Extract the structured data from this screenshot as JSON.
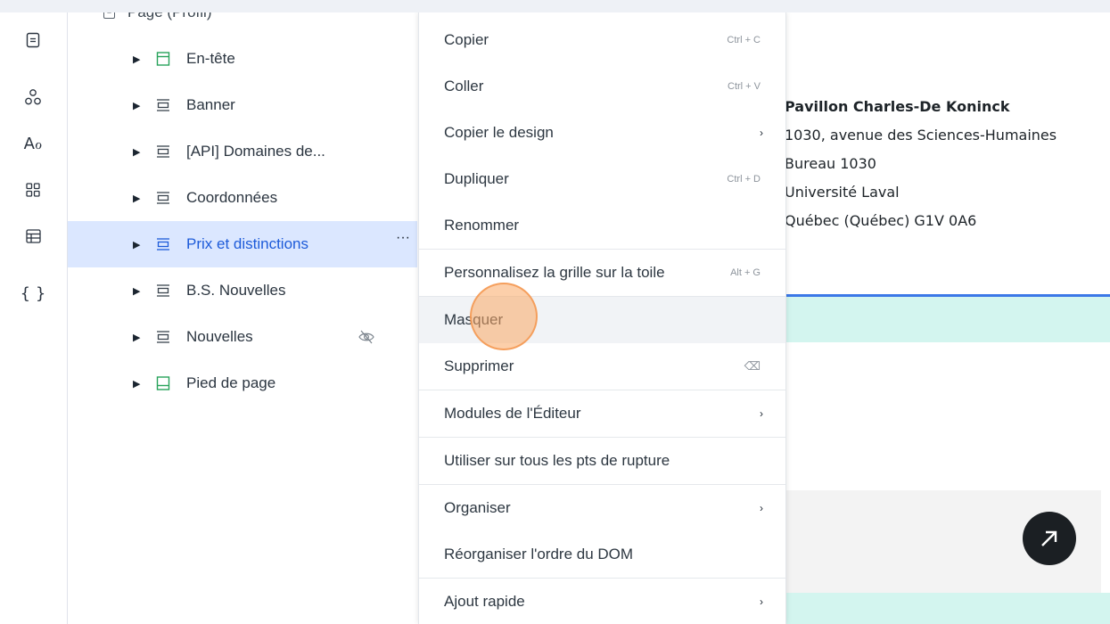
{
  "layers_panel": {
    "page_label": "Page (Profil)",
    "items": [
      {
        "label": "En-tête",
        "icon": "header-section-icon",
        "hidden": false,
        "selected": false
      },
      {
        "label": "Banner",
        "icon": "section-icon",
        "hidden": false,
        "selected": false
      },
      {
        "label": "[API] Domaines de...",
        "icon": "section-icon",
        "hidden": false,
        "selected": false
      },
      {
        "label": "Coordonnées",
        "icon": "section-icon",
        "hidden": false,
        "selected": false
      },
      {
        "label": "Prix et distinctions",
        "icon": "section-icon",
        "hidden": false,
        "selected": true
      },
      {
        "label": "B.S. Nouvelles",
        "icon": "section-icon",
        "hidden": false,
        "selected": false
      },
      {
        "label": "Nouvelles",
        "icon": "section-icon",
        "hidden": true,
        "selected": false
      },
      {
        "label": "Pied de page",
        "icon": "footer-section-icon",
        "hidden": false,
        "selected": false
      }
    ],
    "more_label": "···"
  },
  "context_menu": {
    "items": [
      {
        "label": "Copier",
        "shortcut": "Ctrl + C"
      },
      {
        "label": "Coller",
        "shortcut": "Ctrl + V"
      },
      {
        "label": "Copier le design",
        "submenu": true
      },
      {
        "label": "Dupliquer",
        "shortcut": "Ctrl + D"
      },
      {
        "label": "Renommer"
      },
      {
        "label": "Personnalisez la grille sur la toile",
        "shortcut": "Alt + G"
      },
      {
        "label": "Masquer",
        "hover": true
      },
      {
        "label": "Supprimer",
        "shortcut_icon": "backspace-icon"
      },
      {
        "label": "Modules de l'Éditeur",
        "submenu": true
      },
      {
        "label": "Utiliser sur tous les pts de rupture"
      },
      {
        "label": "Organiser",
        "submenu": true
      },
      {
        "label": "Réorganiser l'ordre du DOM"
      },
      {
        "label": "Ajout rapide",
        "submenu": true
      }
    ],
    "submenu_glyph": "›",
    "backspace_glyph": "⌫"
  },
  "canvas": {
    "address": {
      "building": "Pavillon Charles-De Koninck",
      "street": "1030, avenue des Sciences-Humaines",
      "office": "Bureau 1030",
      "university": "Université Laval",
      "city": "Québec (Québec) G1V 0A6"
    }
  },
  "colors": {
    "selected_bg": "#dbe7ff",
    "selected_text": "#1d5bd9",
    "teal": "#d3f5ef",
    "accent_line": "#3b78e7",
    "green_icon": "#27a35a"
  }
}
